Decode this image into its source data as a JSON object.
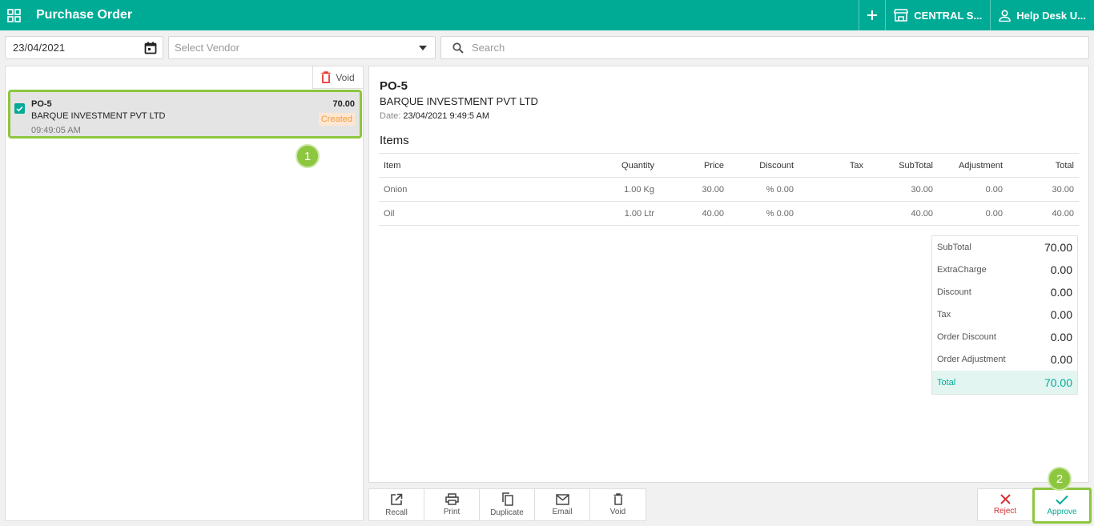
{
  "header": {
    "title": "Purchase Order",
    "location": "CENTRAL S...",
    "user": "Help Desk U..."
  },
  "filters": {
    "date": "23/04/2021",
    "vendor_placeholder": "Select Vendor",
    "search_placeholder": "Search"
  },
  "list": {
    "void_label": "Void",
    "orders": [
      {
        "po": "PO-5",
        "vendor": "BARQUE INVESTMENT PVT LTD",
        "time": "09:49:05 AM",
        "amount": "70.00",
        "status": "Created",
        "selected": true
      }
    ]
  },
  "detail": {
    "po": "PO-5",
    "vendor": "BARQUE INVESTMENT PVT LTD",
    "date_label": "Date:",
    "date": "23/04/2021 9:49:5 AM",
    "items_heading": "Items",
    "columns": [
      "Item",
      "Quantity",
      "Price",
      "Discount",
      "Tax",
      "SubTotal",
      "Adjustment",
      "Total"
    ],
    "rows": [
      [
        "Onion",
        "1.00 Kg",
        "30.00",
        "% 0.00",
        "",
        "30.00",
        "0.00",
        "30.00"
      ],
      [
        "Oil",
        "1.00 Ltr",
        "40.00",
        "% 0.00",
        "",
        "40.00",
        "0.00",
        "40.00"
      ]
    ],
    "summary": [
      {
        "label": "SubTotal",
        "value": "70.00"
      },
      {
        "label": "ExtraCharge",
        "value": "0.00"
      },
      {
        "label": "Discount",
        "value": "0.00"
      },
      {
        "label": "Tax",
        "value": "0.00"
      },
      {
        "label": "Order Discount",
        "value": "0.00"
      },
      {
        "label": "Order Adjustment",
        "value": "0.00"
      }
    ],
    "total_label": "Total",
    "total_value": "70.00"
  },
  "toolbar": {
    "recall": "Recall",
    "print": "Print",
    "duplicate": "Duplicate",
    "email": "Email",
    "void": "Void",
    "reject": "Reject",
    "approve": "Approve"
  },
  "markers": {
    "one": "1",
    "two": "2"
  },
  "colors": {
    "brand": "#00ab96",
    "highlight": "#8dc63f",
    "reject": "#d63031",
    "status_created": "#f39c40"
  }
}
